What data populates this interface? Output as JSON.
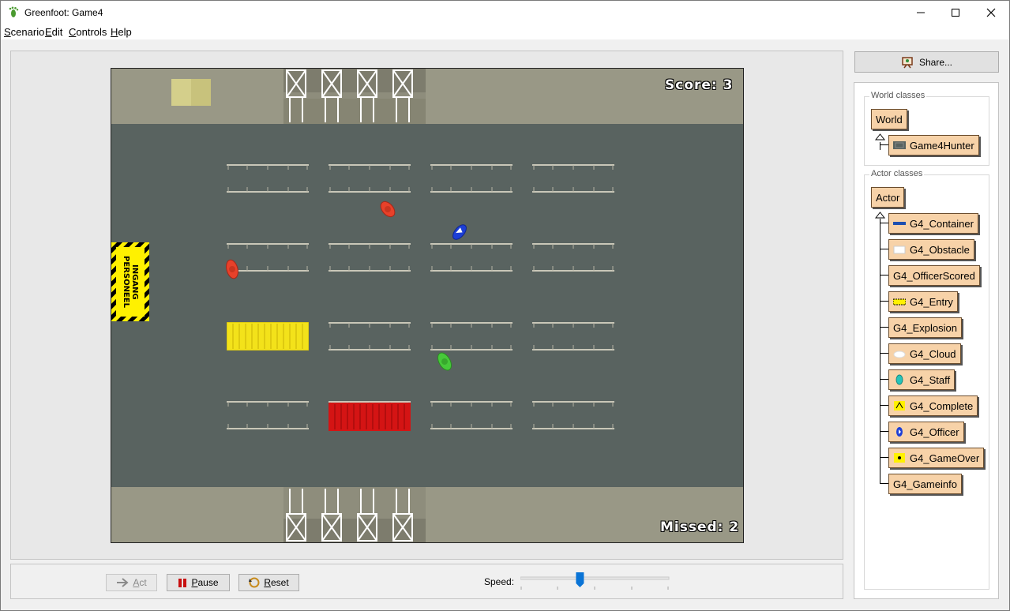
{
  "window": {
    "title": "Greenfoot: Game4"
  },
  "menu": [
    "Scenario",
    "Edit",
    "Controls",
    "Help"
  ],
  "world": {
    "score_text": "Score: 3",
    "missed_text": "Missed: 2",
    "entry_sign": "INGANG PERSONEEL"
  },
  "controls": {
    "act_label": "Act",
    "pause_label": "Pause",
    "reset_label": "Reset",
    "speed_label": "Speed:",
    "speed_value": 0.4
  },
  "share_label": "Share...",
  "classes": {
    "world_title": "World classes",
    "world_root": "World",
    "world_sub": [
      "Game4Hunter"
    ],
    "actor_title": "Actor classes",
    "actor_root": "Actor",
    "actor_sub": [
      "G4_Container",
      "G4_Obstacle",
      "G4_OfficerScored",
      "G4_Entry",
      "G4_Explosion",
      "G4_Cloud",
      "G4_Staff",
      "G4_Complete",
      "G4_Officer",
      "G4_GameOver",
      "G4_Gameinfo"
    ]
  },
  "colors": {
    "road": "#596360",
    "sidewalk": "#999886",
    "class_box": "#f7d2a8",
    "container_yellow": "#f3e21a",
    "container_red": "#d41414",
    "staff_red": "#e8412a",
    "staff_green": "#47c93a",
    "officer_blue": "#1d3fd6"
  }
}
